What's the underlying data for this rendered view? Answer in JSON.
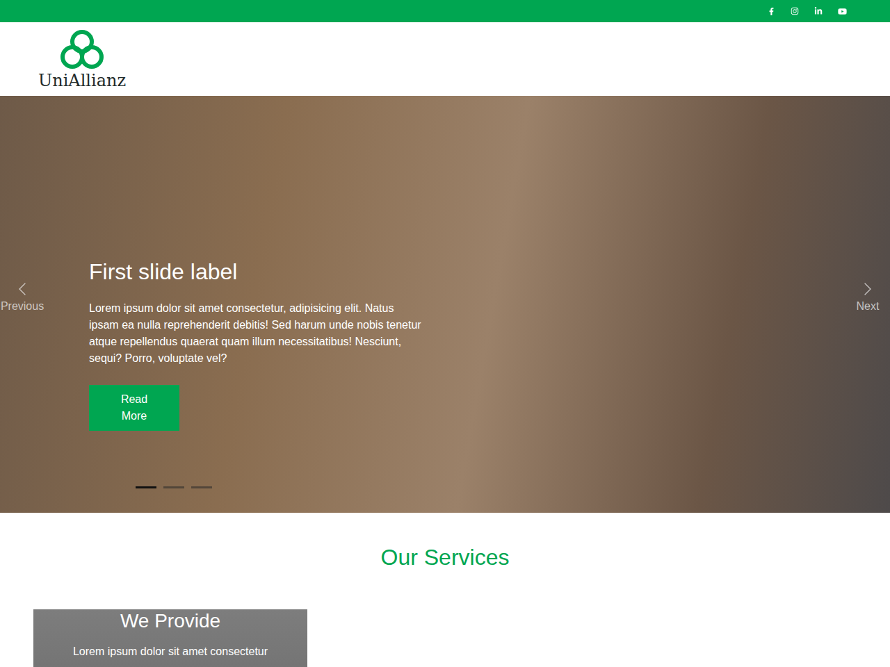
{
  "logo": {
    "text": "UniAllianz"
  },
  "carousel": {
    "slide": {
      "title": "First slide label",
      "text": "Lorem ipsum dolor sit amet consectetur, adipisicing elit. Natus ipsam ea nulla reprehenderit debitis! Sed harum unde nobis tenetur atque repellendus quaerat quam illum necessitatibus! Nesciunt, sequi? Porro, voluptate vel?",
      "button": "Read More"
    },
    "indicators": [
      {
        "selected": true
      },
      {
        "selected": false
      },
      {
        "selected": false
      }
    ],
    "controls": {
      "previous": "Previous",
      "next": "Next"
    }
  },
  "services": {
    "title": "Our Services",
    "cards": [
      {
        "title": "We Provide",
        "text": "Lorem ipsum dolor sit amet consectetur"
      }
    ]
  }
}
